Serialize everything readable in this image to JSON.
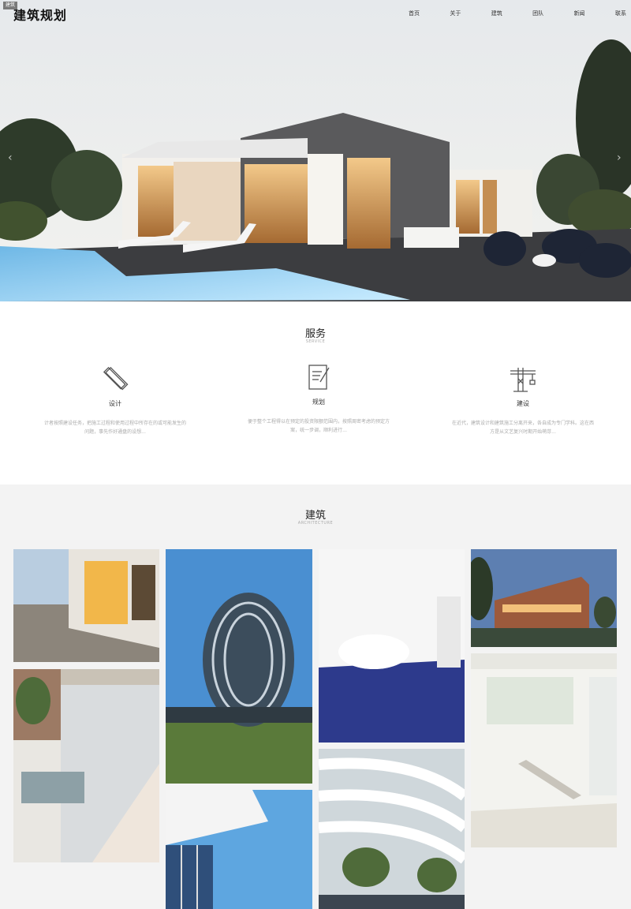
{
  "brand": {
    "badge": "建筑",
    "name": "建筑规划"
  },
  "nav": [
    "首页",
    "关于",
    "建筑",
    "团队",
    "新闻",
    "联系"
  ],
  "hero": {
    "prev_icon": "‹",
    "next_icon": "›"
  },
  "services": {
    "title": "服务",
    "subtitle": "SERVICE",
    "items": [
      {
        "icon": "pencil-ruler-icon",
        "name": "设计",
        "desc": "计者按照建设任务，把施工过程和使用过程中所存在的或可能发生的问题，事先作好通盘的设想..."
      },
      {
        "icon": "document-edit-icon",
        "name": "规划",
        "desc": "便于整个工程得以在预定的投资限额范围内，按照周密考虑的预定方案，统一步调，顺利进行..."
      },
      {
        "icon": "crane-icon",
        "name": "建设",
        "desc": "在近代，建筑设计和建筑施工分离开来，各自成为专门学科。这在西方是从文艺复兴时期开始萌芽..."
      }
    ]
  },
  "architecture": {
    "title": "建筑",
    "subtitle": "ARCHITECTURE"
  }
}
